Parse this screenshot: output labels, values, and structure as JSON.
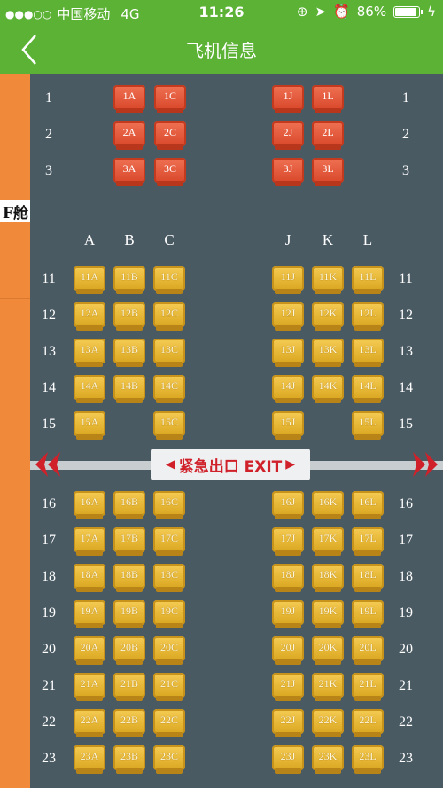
{
  "status_bar": {
    "carrier": "中国移动",
    "network": "4G",
    "time": "11:26",
    "battery": "86%",
    "battery_level": 0.86
  },
  "nav": {
    "title": "飞机信息",
    "back_icon": "chevron-left-icon"
  },
  "cabin": {
    "label": "F舱"
  },
  "first_class": {
    "rows": [
      {
        "num": "1",
        "seats": [
          "1A",
          "1C",
          "1J",
          "1L"
        ]
      },
      {
        "num": "2",
        "seats": [
          "2A",
          "2C",
          "2J",
          "2L"
        ]
      },
      {
        "num": "3",
        "seats": [
          "3A",
          "3C",
          "3J",
          "3L"
        ]
      }
    ]
  },
  "economy": {
    "columns": [
      "A",
      "B",
      "C",
      "J",
      "K",
      "L"
    ],
    "rows": [
      {
        "num": "11",
        "seats": [
          "11A",
          "11B",
          "11C",
          "11J",
          "11K",
          "11L"
        ]
      },
      {
        "num": "12",
        "seats": [
          "12A",
          "12B",
          "12C",
          "12J",
          "12K",
          "12L"
        ]
      },
      {
        "num": "13",
        "seats": [
          "13A",
          "13B",
          "13C",
          "13J",
          "13K",
          "13L"
        ]
      },
      {
        "num": "14",
        "seats": [
          "14A",
          "14B",
          "14C",
          "14J",
          "14K",
          "14L"
        ]
      },
      {
        "num": "15",
        "seats": [
          "15A",
          "",
          "15C",
          "15J",
          "",
          "15L"
        ]
      },
      {
        "num": "16",
        "seats": [
          "16A",
          "16B",
          "16C",
          "16J",
          "16K",
          "16L"
        ]
      },
      {
        "num": "17",
        "seats": [
          "17A",
          "17B",
          "17C",
          "17J",
          "17K",
          "17L"
        ]
      },
      {
        "num": "18",
        "seats": [
          "18A",
          "18B",
          "18C",
          "18J",
          "18K",
          "18L"
        ]
      },
      {
        "num": "19",
        "seats": [
          "19A",
          "19B",
          "19C",
          "19J",
          "19K",
          "19L"
        ]
      },
      {
        "num": "20",
        "seats": [
          "20A",
          "20B",
          "20C",
          "20J",
          "20K",
          "20L"
        ]
      },
      {
        "num": "21",
        "seats": [
          "21A",
          "21B",
          "21C",
          "21J",
          "21K",
          "21L"
        ]
      },
      {
        "num": "22",
        "seats": [
          "22A",
          "22B",
          "22C",
          "22J",
          "22K",
          "22L"
        ]
      },
      {
        "num": "23",
        "seats": [
          "23A",
          "23B",
          "23C",
          "23J",
          "23K",
          "23L"
        ]
      }
    ]
  },
  "exit": {
    "label": "紧急出口 EXIT"
  },
  "colors": {
    "header": "#5bb234",
    "background": "#4a5a63",
    "cabin_sidebar": "#f08a3a",
    "first_seat": "#e05535",
    "economy_seat": "#e8b838",
    "exit_text": "#d0202a"
  }
}
